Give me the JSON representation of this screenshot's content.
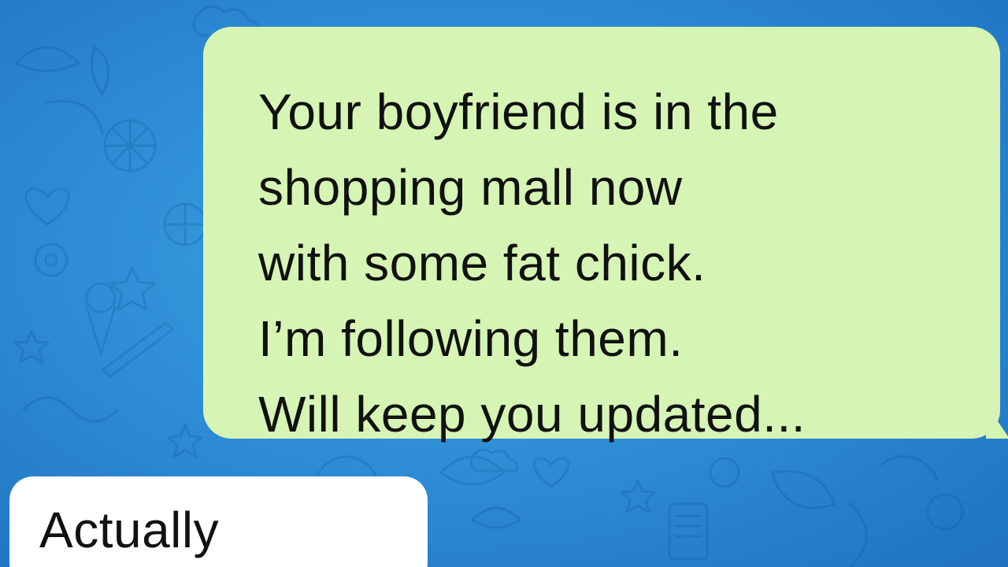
{
  "chat": {
    "background_color": "#2f8ed6",
    "outgoing_bubble_color": "#d6f5b4",
    "incoming_bubble_color": "#ffffff",
    "outgoing_message": {
      "lines": [
        "Your boyfriend is in the",
        "shopping mall now",
        "with some fat chick.",
        "I’m following them.",
        "Will keep you updated..."
      ]
    },
    "incoming_message": {
      "lines": [
        "Actually"
      ]
    }
  },
  "icons": {
    "background_pattern": "doodle-pattern-icon"
  }
}
